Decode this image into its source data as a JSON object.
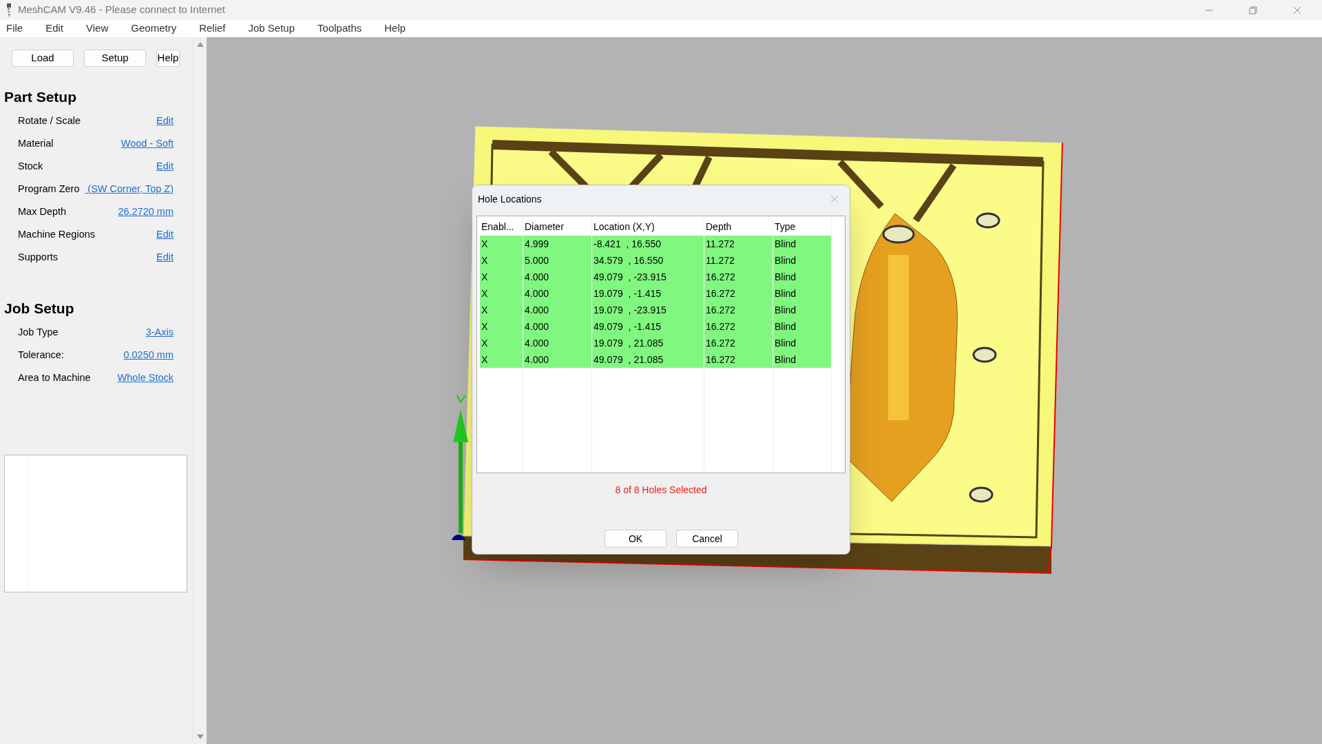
{
  "window": {
    "title": "MeshCAM V9.46 - Please connect to Internet"
  },
  "menu": [
    "File",
    "Edit",
    "View",
    "Geometry",
    "Relief",
    "Job Setup",
    "Toolpaths",
    "Help"
  ],
  "toolbar": [
    "Load",
    "Setup",
    "Help"
  ],
  "sections": [
    {
      "title": "Part Setup",
      "rows": [
        {
          "label": "Rotate / Scale",
          "link": "Edit"
        },
        {
          "label": "Material",
          "link": "Wood - Soft"
        },
        {
          "label": "Stock",
          "link": "Edit"
        },
        {
          "label": "Program Zero",
          "link": " (SW Corner, Top Z)"
        },
        {
          "label": "Max Depth",
          "link": "26.2720 mm"
        },
        {
          "label": "Machine Regions",
          "link": "Edit"
        },
        {
          "label": "Supports",
          "link": "Edit"
        }
      ]
    },
    {
      "title": "Job Setup",
      "rows": [
        {
          "label": "Job Type",
          "link": "3-Axis"
        },
        {
          "label": "Tolerance:",
          "link": "0.0250 mm"
        },
        {
          "label": "Area to Machine",
          "link": "Whole Stock"
        }
      ]
    }
  ],
  "dialog": {
    "title": "Hole Locations",
    "columns": [
      "Enabl...",
      "Diameter",
      "Location (X,Y)",
      "Depth",
      "Type"
    ],
    "rows": [
      {
        "cells": [
          "X",
          "4.999",
          "-8.421  , 16.550",
          "11.272",
          "Blind"
        ],
        "selected": true
      },
      {
        "cells": [
          "X",
          "5.000",
          "34.579  , 16.550",
          "11.272",
          "Blind"
        ],
        "selected": true
      },
      {
        "cells": [
          "X",
          "4.000",
          "49.079  , -23.915",
          "16.272",
          "Blind"
        ],
        "selected": true
      },
      {
        "cells": [
          "X",
          "4.000",
          "19.079  , -1.415",
          "16.272",
          "Blind"
        ],
        "selected": true
      },
      {
        "cells": [
          "X",
          "4.000",
          "19.079  , -23.915",
          "16.272",
          "Blind"
        ],
        "selected": true
      },
      {
        "cells": [
          "X",
          "4.000",
          "49.079  , -1.415",
          "16.272",
          "Blind"
        ],
        "selected": true
      },
      {
        "cells": [
          "X",
          "4.000",
          "19.079  , 21.085",
          "16.272",
          "Blind"
        ],
        "selected": true
      },
      {
        "cells": [
          "X",
          "4.000",
          "49.079  , 21.085",
          "16.272",
          "Blind"
        ],
        "selected": true
      }
    ],
    "status": "8 of 8 Holes Selected",
    "buttons": [
      "OK",
      "Cancel"
    ]
  }
}
